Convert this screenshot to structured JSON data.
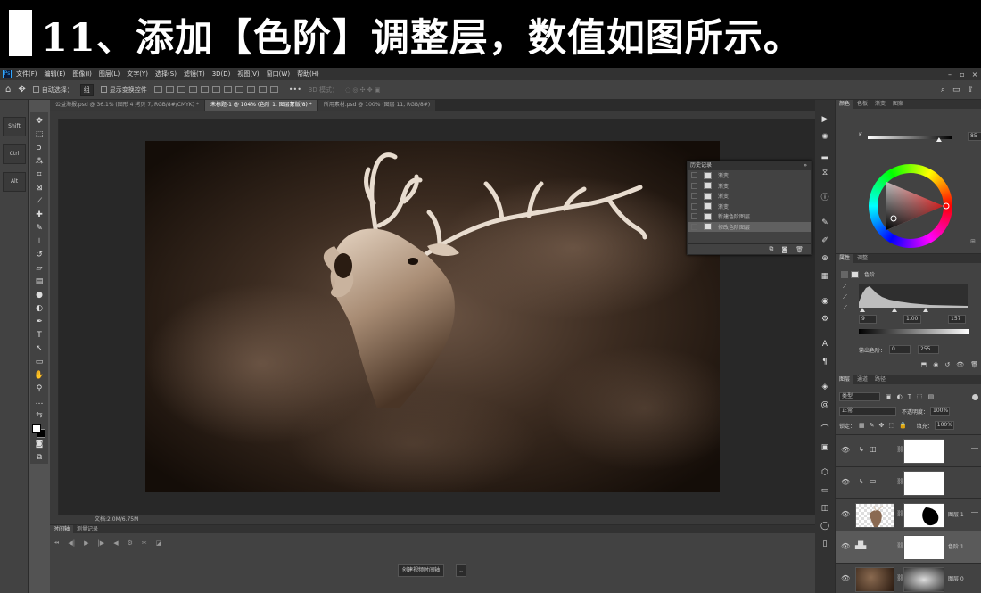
{
  "caption": {
    "text": "11、添加【色阶】调整层，数值如图所示。"
  },
  "app": {
    "logo": "Ps"
  },
  "menu": {
    "items": [
      "文件(F)",
      "编辑(E)",
      "图像(I)",
      "图层(L)",
      "文字(Y)",
      "选择(S)",
      "滤镜(T)",
      "3D(D)",
      "视图(V)",
      "窗口(W)",
      "帮助(H)"
    ]
  },
  "options": {
    "auto_select_label": "自动选择：",
    "auto_select_value": "组",
    "show_transform_label": "显示变换控件",
    "mode_3d_label": "3D 模式："
  },
  "left_keys": [
    "Shift",
    "Ctrl",
    "Alt"
  ],
  "tabs": [
    {
      "label": "公益海报.psd @ 36.1% (图形 4 拷贝 7, RGB/8#/CMYK) *",
      "active": false
    },
    {
      "label": "未标题-1 @ 104% (色阶 1, 图层蒙版/8) *",
      "active": true
    },
    {
      "label": "所用素材.psd @ 100% (图层 11, RGB/8#)",
      "active": false
    }
  ],
  "status": {
    "doc": "文档:2.0M/6.75M"
  },
  "timeline": {
    "tabs": [
      "时间轴",
      "测量记录"
    ],
    "create_button": "创建视频时间轴"
  },
  "history": {
    "title": "历史记录",
    "rows": [
      {
        "label": "渐变",
        "icon": "gradient",
        "selected": false
      },
      {
        "label": "渐变",
        "icon": "gradient",
        "selected": false
      },
      {
        "label": "渐变",
        "icon": "gradient",
        "selected": false
      },
      {
        "label": "渐变",
        "icon": "gradient",
        "selected": false
      },
      {
        "label": "新建色阶图层",
        "icon": "layer",
        "selected": false
      },
      {
        "label": "修改色阶图层",
        "icon": "layer",
        "selected": true
      }
    ]
  },
  "color_panel": {
    "tabs": [
      "颜色",
      "色板",
      "渐变",
      "图案"
    ],
    "k_label": "K",
    "k_value": "85",
    "k_level": 0.85
  },
  "properties": {
    "tabs": [
      "属性",
      "调整"
    ],
    "preset_label": "色阶",
    "input_black": "9",
    "input_gamma": "1.00",
    "input_white": "157",
    "output_label": "输出色阶：",
    "output_black": "0",
    "output_white": "255"
  },
  "layers_panel": {
    "tabs": [
      "图层",
      "通道",
      "路径"
    ],
    "kind_filter": "类型",
    "blend_mode": "正常",
    "opacity_label": "不透明度：",
    "opacity_value": "100%",
    "lock_label": "锁定：",
    "fill_label": "填充：",
    "fill_value": "100%",
    "layers": [
      {
        "name": "",
        "type": "adjustment-curves",
        "selected": false
      },
      {
        "name": "",
        "type": "adjustment-gradient",
        "selected": false
      },
      {
        "name": "图层 1",
        "type": "image-deer",
        "selected": false
      },
      {
        "name": "色阶 1",
        "type": "adjustment-levels",
        "selected": true
      },
      {
        "name": "图层 0",
        "type": "image-smoke",
        "selected": false
      }
    ]
  },
  "colors": {
    "accent": "#31a8ff",
    "panel": "#424242",
    "dark": "#323232",
    "selected_row": "#606060"
  }
}
